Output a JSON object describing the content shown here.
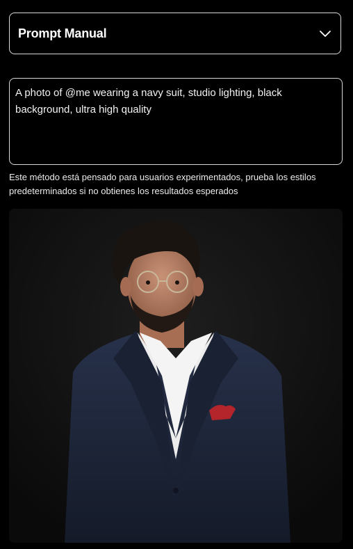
{
  "dropdown": {
    "label": "Prompt Manual",
    "icon": "chevron-down-icon"
  },
  "prompt": {
    "value": "A photo of @me wearing a navy suit, studio lighting, black background, ultra high quality"
  },
  "hint": {
    "text": "Este método está pensado para usuarios experimentados, prueba los estilos predeterminados si no obtienes los resultados esperados"
  },
  "colors": {
    "background": "#000000",
    "border": "#d9d9d9",
    "suit": "#1c2437",
    "pocket_square": "#b3242b"
  }
}
